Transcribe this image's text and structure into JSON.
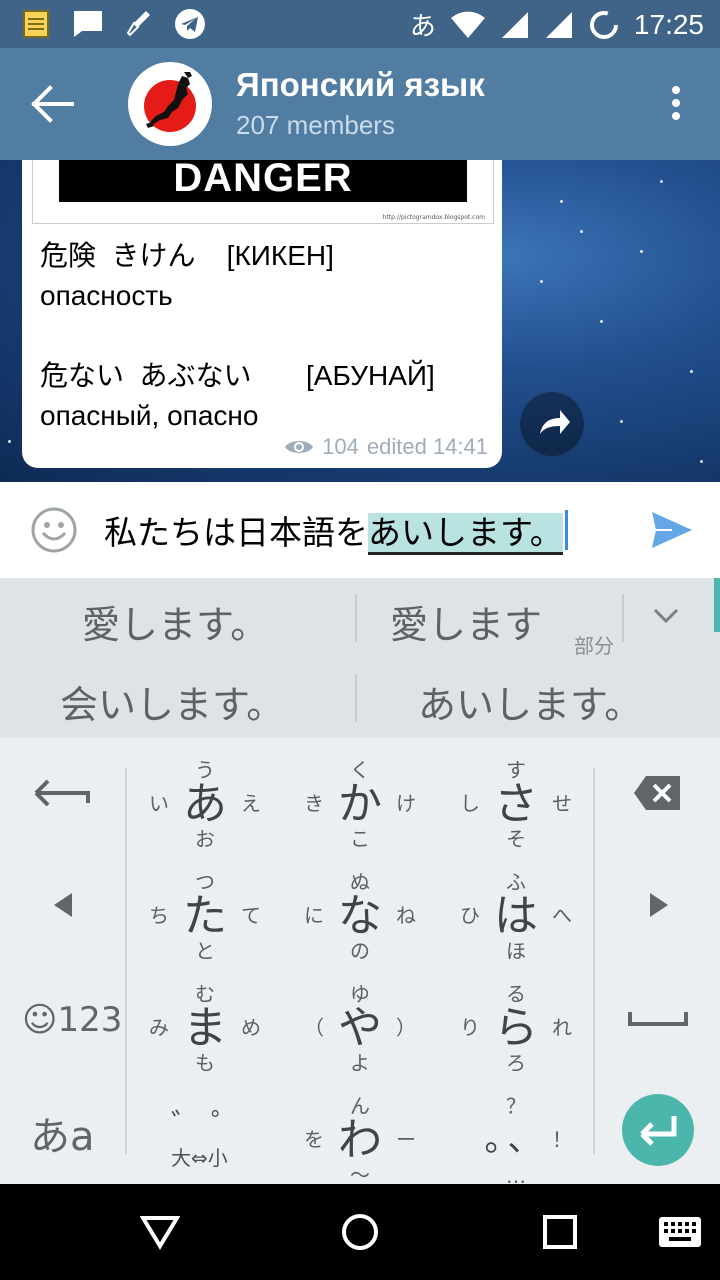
{
  "status_bar": {
    "ime_indicator": "あ",
    "time": "17:25",
    "icons": [
      "notes-icon",
      "message-icon",
      "dropper-icon",
      "telegram-icon",
      "wifi-icon",
      "signal-icon",
      "signal-icon",
      "loading-icon"
    ]
  },
  "header": {
    "title": "Японский язык",
    "subtitle": "207 members",
    "colors": {
      "status_bar": "#3f6487",
      "header": "#517da2"
    }
  },
  "message": {
    "image_text": "DANGER",
    "image_credit": "http://pictogramdox.blogspot.com",
    "text": "危険  きけん    [КИКЕН]\nопасность\n\n危ない  あぶない       [АБУНАЙ]\nопасный, опасно",
    "views": "104",
    "edited": "edited 14:41"
  },
  "input": {
    "committed_text": "私たちは日本語を",
    "composing_text": "あいします。"
  },
  "suggestions": {
    "row1": [
      "愛します。",
      "愛します"
    ],
    "row1_sub": "部分",
    "row2": [
      "会いします。",
      "あいします。"
    ]
  },
  "keyboard": {
    "keys": [
      {
        "main": "あ",
        "up": "う",
        "down": "お",
        "left": "い",
        "right": "え"
      },
      {
        "main": "か",
        "up": "く",
        "down": "こ",
        "left": "き",
        "right": "け"
      },
      {
        "main": "さ",
        "up": "す",
        "down": "そ",
        "left": "し",
        "right": "せ"
      },
      {
        "main": "た",
        "up": "つ",
        "down": "と",
        "left": "ち",
        "right": "て"
      },
      {
        "main": "な",
        "up": "ぬ",
        "down": "の",
        "left": "に",
        "right": "ね"
      },
      {
        "main": "は",
        "up": "ふ",
        "down": "ほ",
        "left": "ひ",
        "right": "へ"
      },
      {
        "main": "ま",
        "up": "む",
        "down": "も",
        "left": "み",
        "right": "め"
      },
      {
        "main": "や",
        "up": "ゆ",
        "down": "よ",
        "left": "（",
        "right": "）"
      },
      {
        "main": "ら",
        "up": "る",
        "down": "ろ",
        "left": "り",
        "right": "れ"
      },
      {
        "main": "わ",
        "up": "ん",
        "down": "〜",
        "left": "を",
        "right": "ー"
      }
    ],
    "dakuten_label": "゛゜",
    "dakuten_sub": "大⇔小",
    "punct_main": "。、",
    "punct_up": "？",
    "punct_right": "！",
    "punct_down": "…",
    "emoji_num_label": "☺123",
    "mode_label": "あa",
    "accent": "#4db6ac"
  }
}
